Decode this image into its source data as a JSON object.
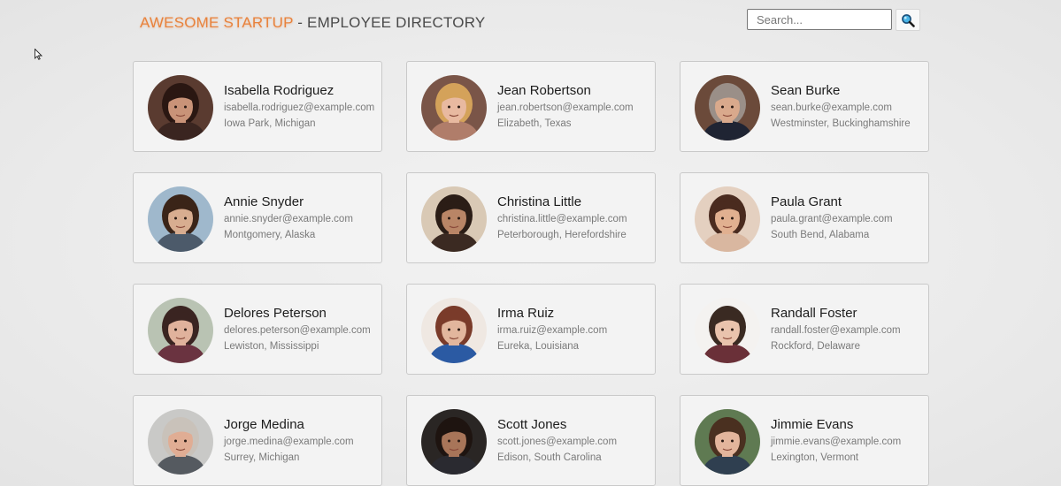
{
  "header": {
    "brand_accent": "AWESOME STARTUP",
    "brand_rest": " - EMPLOYEE DIRECTORY",
    "accent_color": "#e8823c"
  },
  "search": {
    "placeholder": "Search...",
    "value": "",
    "button_icon": "magnifier-icon"
  },
  "employees": [
    {
      "name": "Isabella Rodriguez",
      "email": "isabella.rodriguez@example.com",
      "location": "Iowa Park, Michigan",
      "skin": "#c99378",
      "hair": "#2a1712",
      "bg": "#5a3b30",
      "shirt": "#3a2520"
    },
    {
      "name": "Jean Robertson",
      "email": "jean.robertson@example.com",
      "location": "Elizabeth, Texas",
      "skin": "#e8b9a0",
      "hair": "#d4a25a",
      "bg": "#7a5548",
      "shirt": "#b07d6a"
    },
    {
      "name": "Sean Burke",
      "email": "sean.burke@example.com",
      "location": "Westminster, Buckinghamshire",
      "skin": "#d9a98c",
      "hair": "#9a8f88",
      "bg": "#6b4a3a",
      "shirt": "#1f2433"
    },
    {
      "name": "Annie Snyder",
      "email": "annie.snyder@example.com",
      "location": "Montgomery, Alaska",
      "skin": "#d8ad90",
      "hair": "#3a2418",
      "bg": "#9fb8cc",
      "shirt": "#4c5a6a"
    },
    {
      "name": "Christina Little",
      "email": "christina.little@example.com",
      "location": "Peterborough, Herefordshire",
      "skin": "#b98566",
      "hair": "#2b1d16",
      "bg": "#d9c9b5",
      "shirt": "#3b2a22"
    },
    {
      "name": "Paula Grant",
      "email": "paula.grant@example.com",
      "location": "South Bend, Alabama",
      "skin": "#e1b090",
      "hair": "#4a2b1f",
      "bg": "#e4d0c0",
      "shirt": "#d9b7a0"
    },
    {
      "name": "Delores Peterson",
      "email": "delores.peterson@example.com",
      "location": "Lewiston, Mississippi",
      "skin": "#e0b29c",
      "hair": "#3a2421",
      "bg": "#b9c3b3",
      "shirt": "#6a3340"
    },
    {
      "name": "Irma Ruiz",
      "email": "irma.ruiz@example.com",
      "location": "Eureka, Louisiana",
      "skin": "#e2b69d",
      "hair": "#7a3b2a",
      "bg": "#efe8e2",
      "shirt": "#2b5aa3"
    },
    {
      "name": "Randall Foster",
      "email": "randall.foster@example.com",
      "location": "Rockford, Delaware",
      "skin": "#e9c3ad",
      "hair": "#3a2a22",
      "bg": "#f4f2f0",
      "shirt": "#6a3038"
    },
    {
      "name": "Jorge Medina",
      "email": "jorge.medina@example.com",
      "location": "Surrey, Michigan",
      "skin": "#e0ad94",
      "hair": "#c9c2ba",
      "bg": "#c9c9c7",
      "shirt": "#555a60"
    },
    {
      "name": "Scott Jones",
      "email": "scott.jones@example.com",
      "location": "Edison, South Carolina",
      "skin": "#a87559",
      "hair": "#1e1410",
      "bg": "#2a2624",
      "shirt": "#2a2a30"
    },
    {
      "name": "Jimmie Evans",
      "email": "jimmie.evans@example.com",
      "location": "Lexington, Vermont",
      "skin": "#e3b59c",
      "hair": "#4a3020",
      "bg": "#5f7a52",
      "shirt": "#2f3f50"
    }
  ]
}
